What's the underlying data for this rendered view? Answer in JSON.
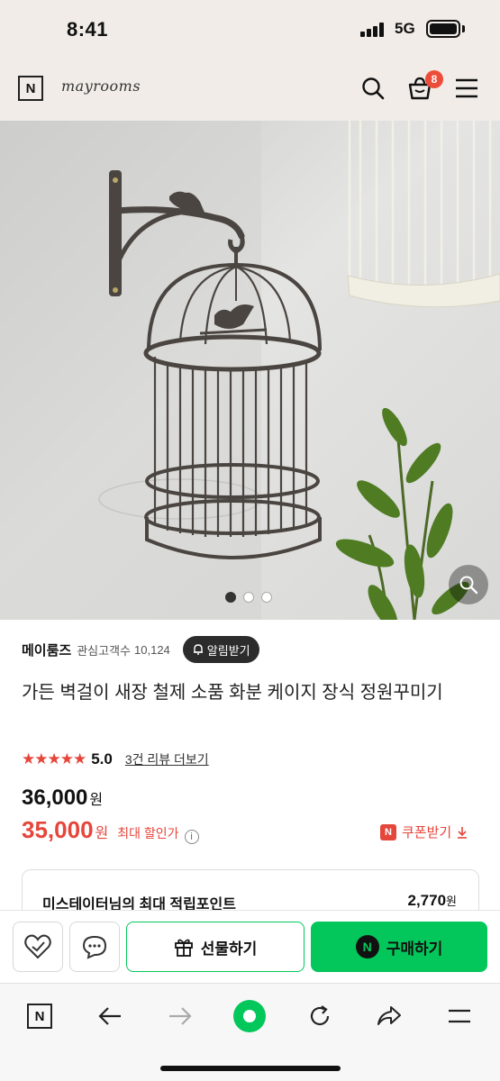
{
  "status_bar": {
    "time": "8:41",
    "network": "5G"
  },
  "header": {
    "logo_letter": "N",
    "brand": "mayrooms",
    "cart_count": "8",
    "icons": [
      "search-icon",
      "cart-icon",
      "menu-icon"
    ]
  },
  "gallery": {
    "page_count": 3,
    "current_page": 1
  },
  "store": {
    "name": "메이룸즈",
    "follower_label": "관심고객수",
    "follower_count": "10,124",
    "alert_label": "알림받기"
  },
  "product": {
    "title": "가든 벽걸이 새장 철제 소품 화분 케이지 장식 정원꾸미기",
    "stars": "★★★★★",
    "rating": "5.0",
    "review_link": "3건 리뷰 더보기",
    "original_price": "36,000",
    "original_currency": "원",
    "sale_price": "35,000",
    "sale_currency": "원",
    "max_discount_label": "최대 할인가",
    "coupon_badge": "N",
    "coupon_label": "쿠폰받기"
  },
  "points": {
    "label": "미스테이터님의 최대 적립포인트",
    "value": "2,770",
    "unit": "원"
  },
  "actions": {
    "gift_label": "선물하기",
    "buy_badge": "N",
    "buy_label": "구매하기"
  },
  "browser": {
    "home_letter": "N"
  },
  "colors": {
    "accent_green": "#03c75a",
    "sale_red": "#e5463b",
    "header_bg": "#f1ece7"
  }
}
